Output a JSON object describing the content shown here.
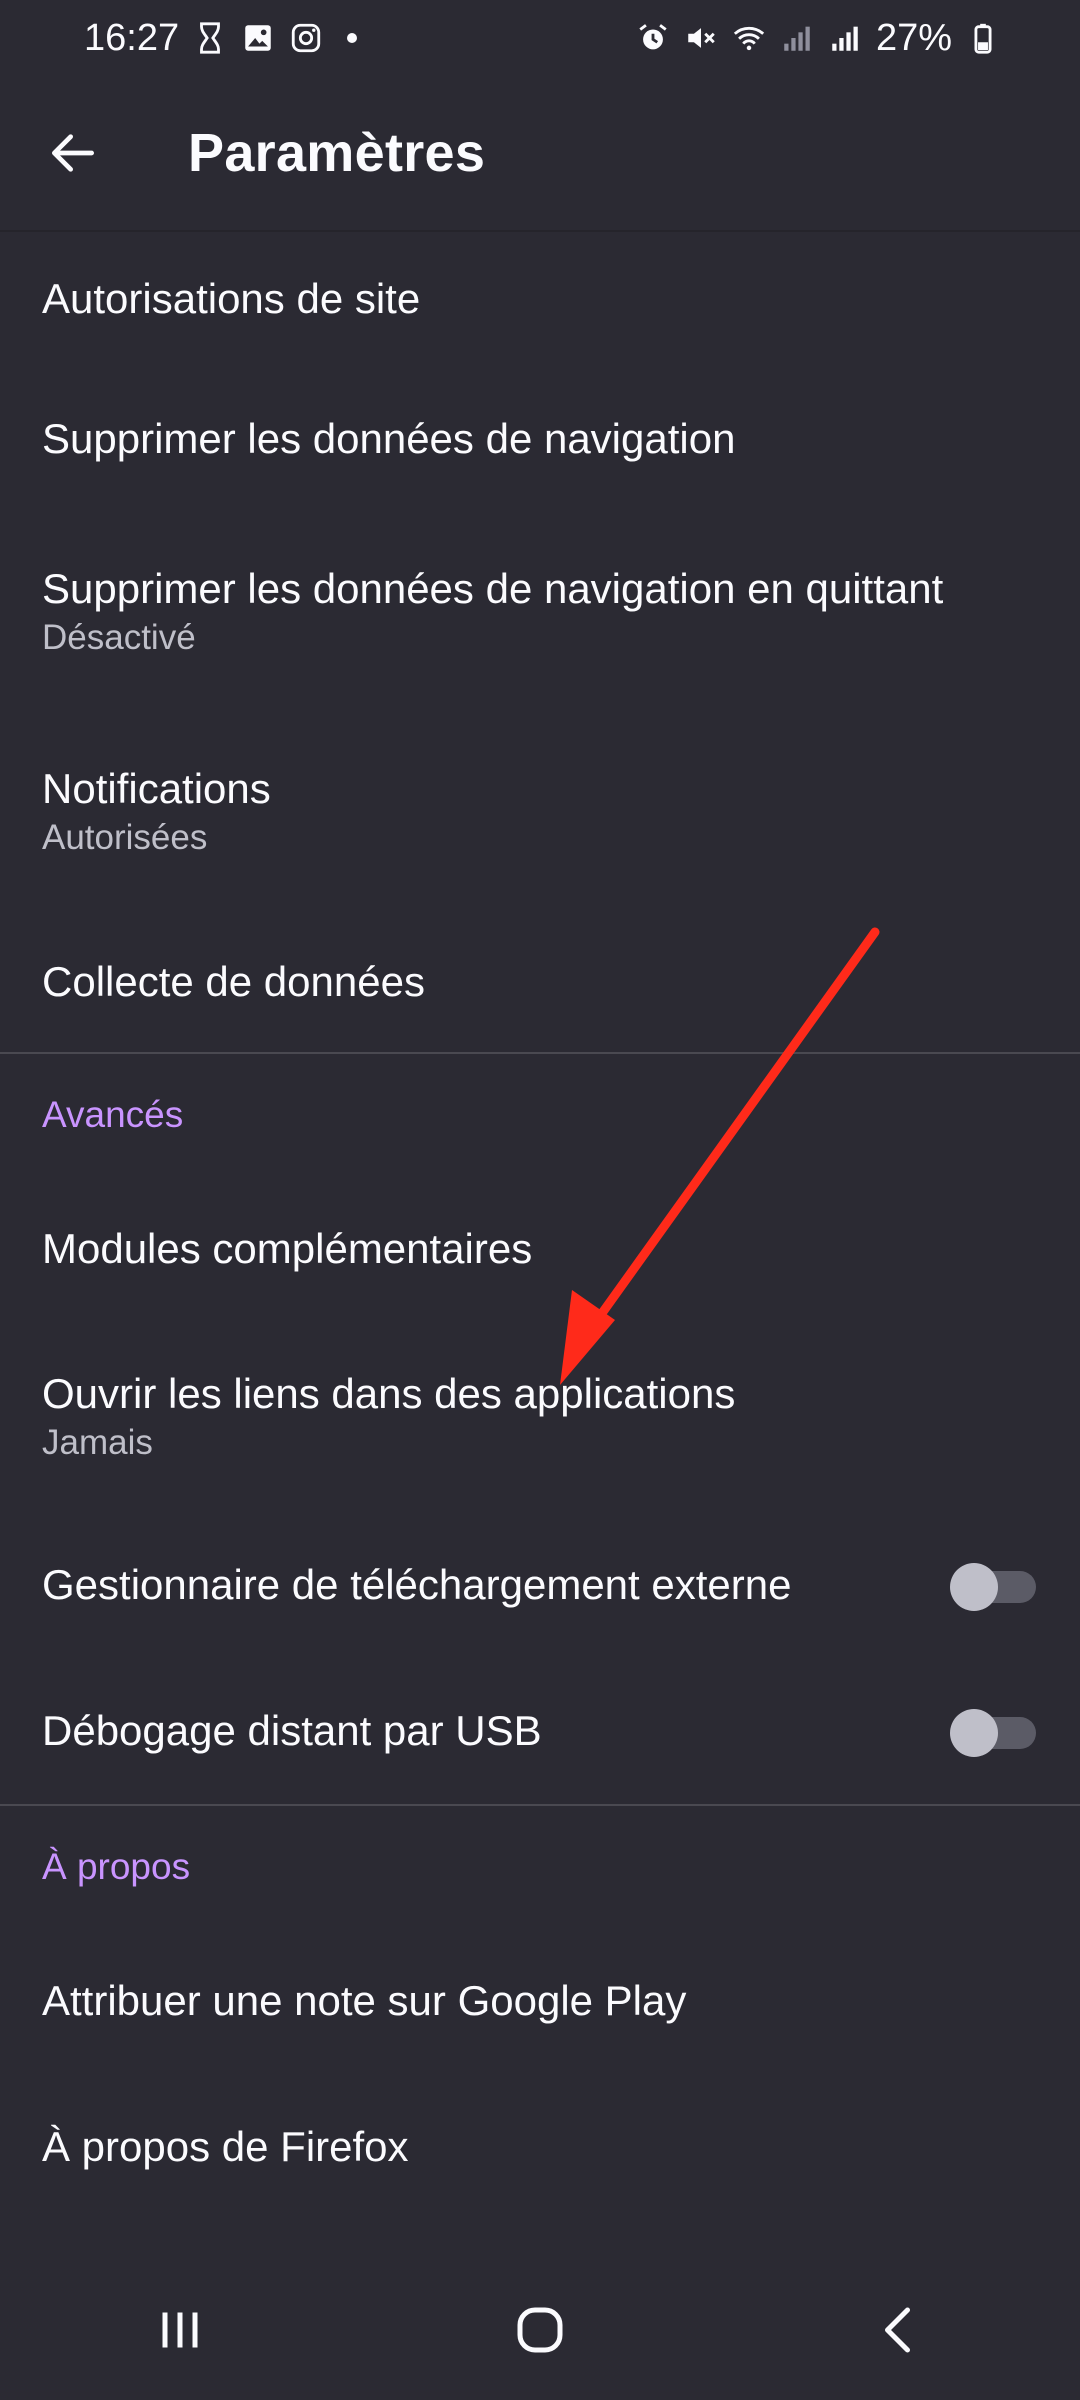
{
  "status": {
    "time": "16:27",
    "battery": "27%"
  },
  "header": {
    "title": "Paramètres"
  },
  "items": {
    "site_permissions": {
      "label": "Autorisations de site"
    },
    "delete_browsing": {
      "label": "Supprimer les données de navigation"
    },
    "delete_on_quit": {
      "label": "Supprimer les données de navigation en quittant",
      "sub": "Désactivé"
    },
    "notifications": {
      "label": "Notifications",
      "sub": "Autorisées"
    },
    "data_collection": {
      "label": "Collecte de données"
    },
    "addons": {
      "label": "Modules complémentaires"
    },
    "open_links": {
      "label": "Ouvrir les liens dans des applications",
      "sub": "Jamais"
    },
    "external_download": {
      "label": "Gestionnaire de téléchargement externe",
      "enabled": false
    },
    "remote_debug": {
      "label": "Débogage distant par USB",
      "enabled": false
    },
    "rate_play": {
      "label": "Attribuer une note sur Google Play"
    },
    "about_firefox": {
      "label": "À propos de Firefox"
    }
  },
  "sections": {
    "advanced": "Avancés",
    "about": "À propos"
  },
  "colors": {
    "background": "#2b2a33",
    "section_header": "#c994ff",
    "annotation_arrow": "#ff2a1a"
  }
}
